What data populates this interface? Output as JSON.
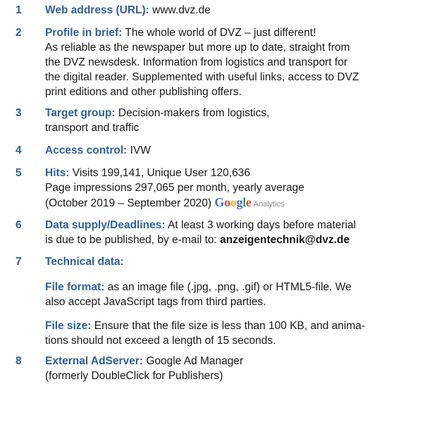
{
  "items": [
    {
      "num": "1",
      "label": "Web address (URL):",
      "lines": [
        "www.dvz.de"
      ]
    },
    {
      "num": "2",
      "label": "Profile in brief:",
      "lines": [
        "The whole world of DVZ – just different!",
        "As reliable as the newspaper but more up to date, straight from",
        "the DVZ newsdesk. Information from logistics and transport for",
        "the digital reader. Supplemented with useful links, access to DVZ",
        "print editions and other publishing offers."
      ]
    },
    {
      "num": "3",
      "label": "Target group:",
      "lines": [
        "Decision-makers from logistics,",
        "transport and traffic"
      ]
    },
    {
      "num": "4",
      "label": "Access control:",
      "lines": [
        "IVW"
      ]
    },
    {
      "num": "5",
      "label": "Hits:",
      "lines": [
        "Visits 199,141, Unique User 120,636",
        "Page impressions 297,065 per month, yearly average",
        "(October 2019 – September 2020)"
      ],
      "logo_word": "Google",
      "logo_sub": "Analytics"
    },
    {
      "num": "6",
      "label": "Data supply/Deadlines:",
      "lines": [
        "At least 3 working days before material",
        "is due to be published, by e-mail to:"
      ],
      "email": "anzeigentechnik@dvz.de"
    },
    {
      "num": "7",
      "label": "Technical data:",
      "lines": []
    },
    {
      "num": "",
      "label": "File format:",
      "lines": [
        "as an image file (.jpg, .png, .gif) or HTML5-file. We",
        "also accept JavaScript tags from third parties."
      ]
    },
    {
      "num": "",
      "label": "File size:",
      "lines": [
        "Ensure that the file size is less than 100 KB, and anima-",
        "tions should not exceed a length of 15 seconds."
      ]
    },
    {
      "num": "8",
      "label": "External AdServer:",
      "lines": [
        "Google Ad Manager",
        "(formerly DoubleClick for Publishers)"
      ]
    }
  ],
  "colors": {
    "label": "#2f5f9e",
    "text": "#1a1a1a"
  }
}
